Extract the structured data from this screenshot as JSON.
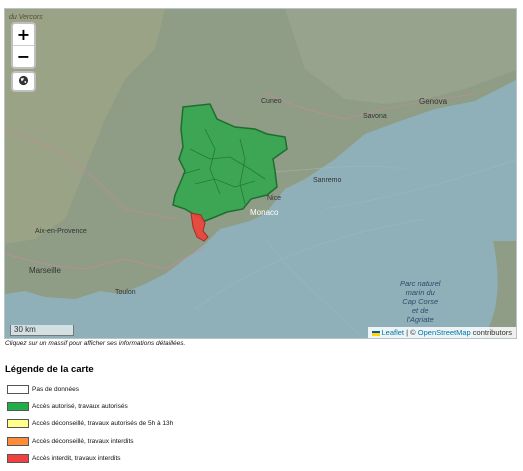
{
  "map": {
    "zoom_in_label": "+",
    "zoom_out_label": "−",
    "scale_label": "30 km",
    "attribution": {
      "leaflet": "Leaflet",
      "separator": " | © ",
      "osm": "OpenStreetMap",
      "contributors": " contributors"
    },
    "labels": {
      "vercors": "du Vercors",
      "genova": "Genova",
      "cuneo": "Cuneo",
      "savona": "Savona",
      "sanremo": "Sanremo",
      "monaco": "Monaco",
      "aix": "Aix-en-Provence",
      "marseille": "Marseille",
      "toulon": "Toulon",
      "nice": "Nice",
      "parc_corse": "Parc naturel\nmarin du\nCap Corse\net de\nl'Agriate"
    },
    "colors": {
      "sea": "#8fb0b8",
      "land": "#8f9c86",
      "authorized": "#2fa84b",
      "forbidden": "#f0433a"
    }
  },
  "hint": "Cliquez sur un massif pour afficher ses informations détaillées.",
  "legend": {
    "title": "Légende de la carte",
    "items": [
      {
        "label": "Pas de données",
        "color": "#ffffff"
      },
      {
        "label": "Accès autorisé, travaux autorisés",
        "color": "#22ad4b"
      },
      {
        "label": "Accès déconseillé, travaux autorisés de 5h à 13h",
        "color": "#ffff8a"
      },
      {
        "label": "Accès déconseillé, travaux interdits",
        "color": "#ff8c3a"
      },
      {
        "label": "Accès interdit, travaux interdits",
        "color": "#f23f3f"
      }
    ]
  }
}
